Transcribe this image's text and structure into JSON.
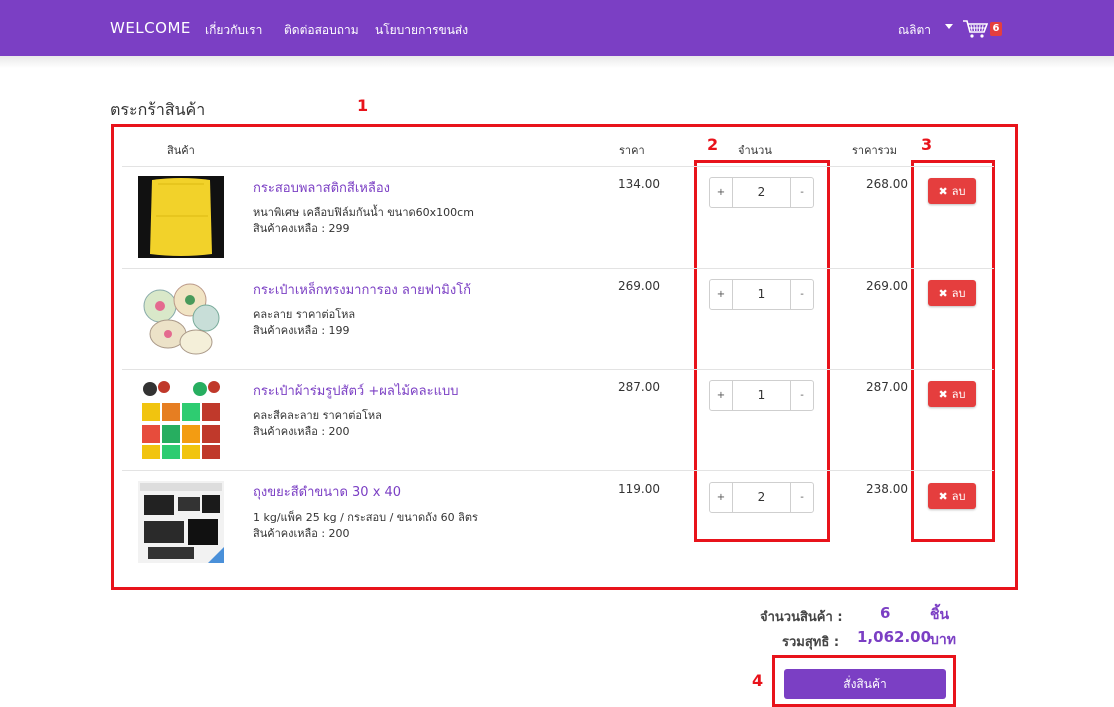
{
  "nav": {
    "brand": "WELCOME",
    "links": [
      "เกี่ยวกับเรา",
      "ติดต่อสอบถาม",
      "นโยบายการขนส่ง"
    ],
    "user": "ณลิตา",
    "cart_count": "6",
    "caret_icon": "caret-down-icon",
    "cart_icon": "shopping-cart-icon"
  },
  "page_title": "ตระกร้าสินค้า",
  "table": {
    "headers": {
      "product": "สินค้า",
      "price": "ราคา",
      "quantity": "จำนวน",
      "total": "ราคารวม"
    },
    "rows": [
      {
        "name": "กระสอบพลาสติกสีเหลือง",
        "desc": "หนาพิเศษ เคลือบฟิล์มกันน้ำ ขนาด60x100cm",
        "stock": "สินค้าคงเหลือ : 299",
        "price": "134.00",
        "qty": "2",
        "total": "268.00",
        "image": "yellow-sack-image"
      },
      {
        "name": "กระเป๋าเหล็กทรงมาการอง ลายฟามิงโก้",
        "desc": "คละลาย ราคาต่อโหล",
        "stock": "สินค้าคงเหลือ : 199",
        "price": "269.00",
        "qty": "1",
        "total": "269.00",
        "image": "macaron-tins-image"
      },
      {
        "name": "กระเป๋าผ้าร่มรูปสัตว์ +ผลไม้คละแบบ",
        "desc": "คละสีคละลาย ราคาต่อโหล",
        "stock": "สินค้าคงเหลือ : 200",
        "price": "287.00",
        "qty": "1",
        "total": "287.00",
        "image": "fruit-bags-image"
      },
      {
        "name": "ถุงขยะสีดำขนาด 30 x 40",
        "desc": "1 kg/แพ็ค 25 kg / กระสอบ / ขนาดถัง 60 ลิตร",
        "stock": "สินค้าคงเหลือ : 200",
        "price": "119.00",
        "qty": "2",
        "total": "238.00",
        "image": "black-garbage-bags-image"
      }
    ],
    "plus_label": "+",
    "minus_label": "-",
    "delete_label": "ลบ",
    "delete_icon": "close-icon"
  },
  "annotations": [
    "1",
    "2",
    "3",
    "4"
  ],
  "summary": {
    "count_label": "จำนวนสินค้า :",
    "count_value": "6",
    "count_unit": "ชิ้น",
    "net_label": "รวมสุทธิ :",
    "net_value": "1,062.00",
    "net_unit": "บาท"
  },
  "order_button": "สั่งสินค้า",
  "colors": {
    "primary": "#7b3fc4",
    "danger": "#e53e3e",
    "annotation": "#e8131b"
  }
}
